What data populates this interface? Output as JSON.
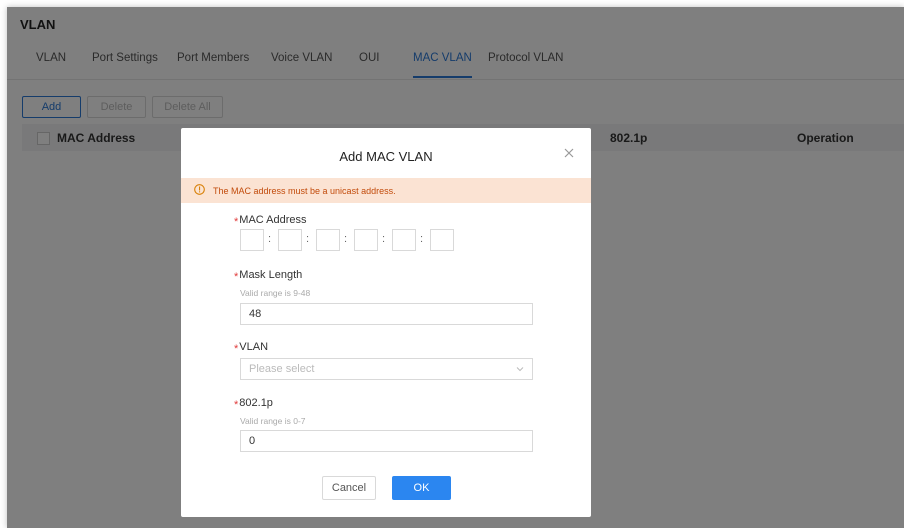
{
  "page": {
    "title": "VLAN"
  },
  "tabs": [
    {
      "label": "VLAN",
      "active": false
    },
    {
      "label": "Port Settings",
      "active": false
    },
    {
      "label": "Port Members",
      "active": false
    },
    {
      "label": "Voice VLAN",
      "active": false
    },
    {
      "label": "OUI",
      "active": false
    },
    {
      "label": "MAC VLAN",
      "active": true
    },
    {
      "label": "Protocol VLAN",
      "active": false
    }
  ],
  "toolbar": {
    "add_label": "Add",
    "delete_label": "Delete",
    "delete_all_label": "Delete All"
  },
  "table": {
    "columns": [
      "MAC Address",
      "802.1p",
      "Operation"
    ]
  },
  "modal": {
    "title": "Add MAC VLAN",
    "alert": "The MAC address must be a unicast address.",
    "mac_address": {
      "label": "MAC Address",
      "segments": [
        "",
        "",
        "",
        "",
        "",
        ""
      ]
    },
    "mask_length": {
      "label": "Mask Length",
      "hint": "Valid range is 9-48",
      "value": "48"
    },
    "vlan": {
      "label": "VLAN",
      "placeholder": "Please select"
    },
    "priority": {
      "label": "802.1p",
      "hint": "Valid range is 0-7",
      "value": "0"
    },
    "cancel_label": "Cancel",
    "ok_label": "OK"
  },
  "colors": {
    "accent": "#2a78d6",
    "ok_button": "#2b86f0",
    "alert_bg": "#fbe3d3",
    "alert_text": "#c24b0b",
    "required": "#e03b3b"
  }
}
